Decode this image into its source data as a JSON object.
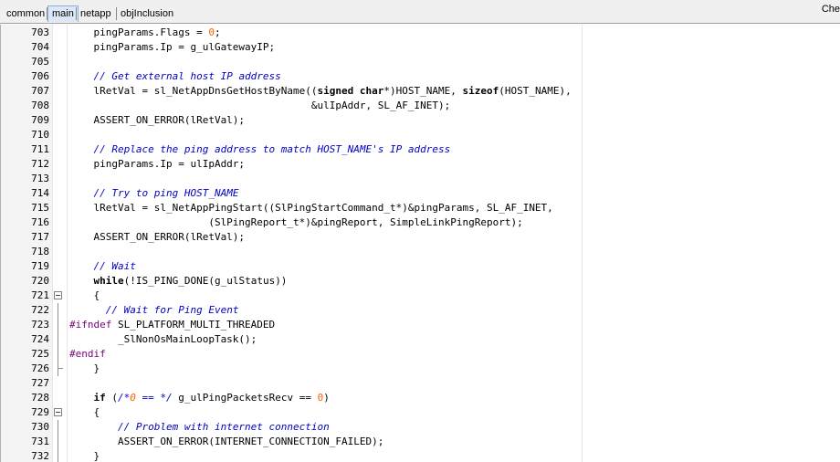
{
  "tabs": [
    {
      "label": "common",
      "active": false
    },
    {
      "label": "main",
      "active": true
    },
    {
      "label": "netapp",
      "active": false
    },
    {
      "label": "objInclusion",
      "active": false
    }
  ],
  "right_label": "Che",
  "lines": [
    {
      "num": "703",
      "text": "    pingParams.Flags = 0;"
    },
    {
      "num": "704",
      "text": "    pingParams.Ip = g_ulGatewayIP;"
    },
    {
      "num": "705",
      "text": ""
    },
    {
      "num": "706",
      "text": "    // Get external host IP address"
    },
    {
      "num": "707",
      "text": "    lRetVal = sl_NetAppDnsGetHostByName((signed char*)HOST_NAME, sizeof(HOST_NAME),"
    },
    {
      "num": "708",
      "text": "                                        &ulIpAddr, SL_AF_INET);"
    },
    {
      "num": "709",
      "text": "    ASSERT_ON_ERROR(lRetVal);"
    },
    {
      "num": "710",
      "text": ""
    },
    {
      "num": "711",
      "text": "    // Replace the ping address to match HOST_NAME's IP address"
    },
    {
      "num": "712",
      "text": "    pingParams.Ip = ulIpAddr;"
    },
    {
      "num": "713",
      "text": ""
    },
    {
      "num": "714",
      "text": "    // Try to ping HOST_NAME"
    },
    {
      "num": "715",
      "text": "    lRetVal = sl_NetAppPingStart((SlPingStartCommand_t*)&pingParams, SL_AF_INET,"
    },
    {
      "num": "716",
      "text": "                       (SlPingReport_t*)&pingReport, SimpleLinkPingReport);"
    },
    {
      "num": "717",
      "text": "    ASSERT_ON_ERROR(lRetVal);"
    },
    {
      "num": "718",
      "text": ""
    },
    {
      "num": "719",
      "text": "    // Wait"
    },
    {
      "num": "720",
      "text": "    while(!IS_PING_DONE(g_ulStatus))"
    },
    {
      "num": "721",
      "text": "    {"
    },
    {
      "num": "722",
      "text": "      // Wait for Ping Event"
    },
    {
      "num": "723",
      "text": "#ifndef SL_PLATFORM_MULTI_THREADED"
    },
    {
      "num": "724",
      "text": "        _SlNonOsMainLoopTask();"
    },
    {
      "num": "725",
      "text": "#endif"
    },
    {
      "num": "726",
      "text": "    }"
    },
    {
      "num": "727",
      "text": ""
    },
    {
      "num": "728",
      "text": "    if (/*0 == */ g_ulPingPacketsRecv == 0)"
    },
    {
      "num": "729",
      "text": "    {"
    },
    {
      "num": "730",
      "text": "        // Problem with internet connection"
    },
    {
      "num": "731",
      "text": "        ASSERT_ON_ERROR(INTERNET_CONNECTION_FAILED);"
    },
    {
      "num": "732",
      "text": "    }"
    }
  ]
}
